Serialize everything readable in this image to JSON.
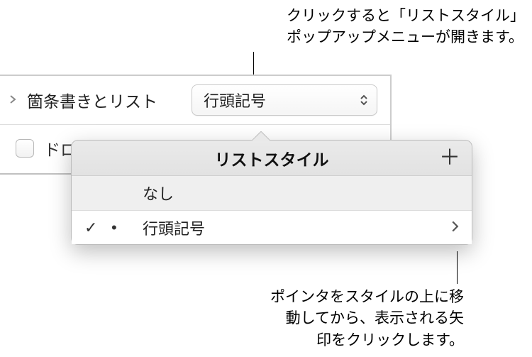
{
  "callouts": {
    "top_line1": "クリックすると「リストスタイル」",
    "top_line2": "ポップアップメニューが開きます。",
    "bottom_line1": "ポインタをスタイルの上に移",
    "bottom_line2": "動してから、表示される矢",
    "bottom_line3": "印をクリックします。"
  },
  "panel": {
    "section_label": "箇条書きとリスト",
    "popup_value": "行頭記号",
    "dropcap_label": "ドロッ"
  },
  "popover": {
    "title": "リストスタイル",
    "items": [
      {
        "label": "なし",
        "selected": false,
        "indicator": ""
      },
      {
        "label": "行頭記号",
        "selected": true,
        "indicator": "•"
      }
    ]
  },
  "icons": {
    "check": "✓",
    "plus": "＋",
    "chevron_right": "›",
    "disclosure_right": "›"
  }
}
